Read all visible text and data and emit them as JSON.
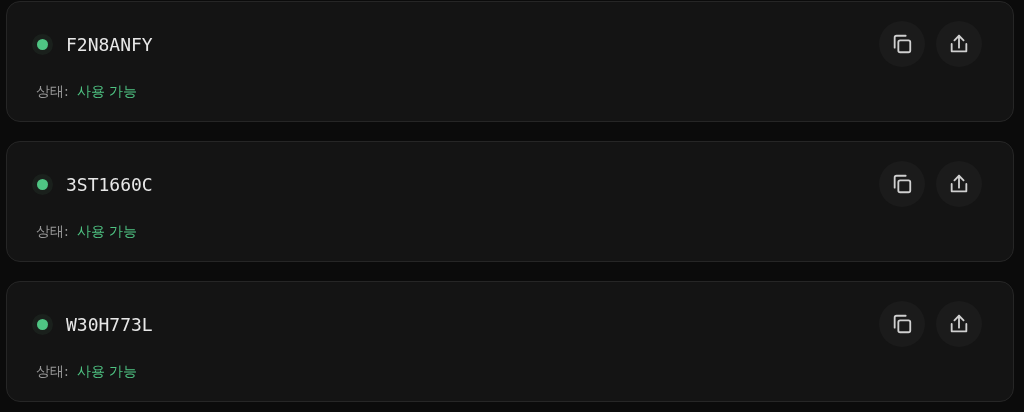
{
  "codes": [
    {
      "code": "F2N8ANFY",
      "status_label": "상태:",
      "status": "사용 가능",
      "available": true
    },
    {
      "code": "3ST1660C",
      "status_label": "상태:",
      "status": "사용 가능",
      "available": true
    },
    {
      "code": "W30H773L",
      "status_label": "상태:",
      "status": "사용 가능",
      "available": true
    }
  ]
}
